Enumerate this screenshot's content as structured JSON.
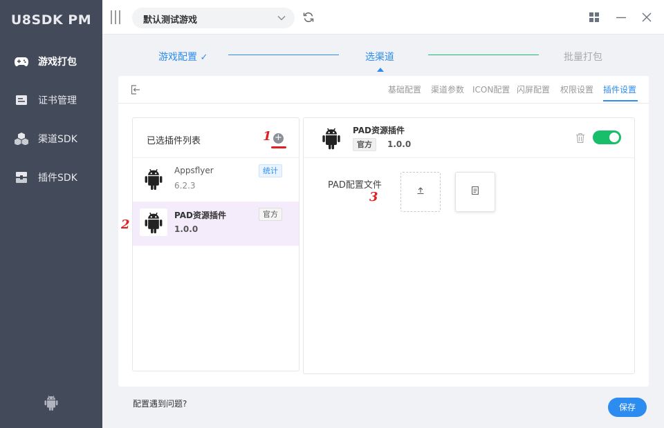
{
  "app": {
    "title": "U8SDK PM"
  },
  "sidebar": {
    "items": [
      {
        "label": "游戏打包",
        "icon": "gamepad-icon",
        "active": true
      },
      {
        "label": "证书管理",
        "icon": "certificate-icon",
        "active": false
      },
      {
        "label": "渠道SDK",
        "icon": "cubes-icon",
        "active": false
      },
      {
        "label": "插件SDK",
        "icon": "plugin-icon",
        "active": false
      }
    ],
    "bottom_icon": "android-icon"
  },
  "topbar": {
    "game_select_value": "默认测试游戏",
    "icons": [
      "menu-toggle-icon",
      "chevron-down-icon",
      "refresh-icon",
      "grid-icon",
      "minimize-icon",
      "close-icon"
    ]
  },
  "steps": [
    {
      "label": "游戏配置",
      "state": "done",
      "check": "✓"
    },
    {
      "label": "选渠道",
      "state": "current"
    },
    {
      "label": "批量打包",
      "state": "todo"
    }
  ],
  "tabs": {
    "items": [
      "基础配置",
      "渠道参数",
      "ICON配置",
      "闪屏配置",
      "权限设置",
      "插件设置"
    ],
    "active_index": 5
  },
  "plugin_list": {
    "title": "已选插件列表",
    "add_symbol": "+",
    "items": [
      {
        "name": "Appsflyer",
        "version": "6.2.3",
        "badge": "统计",
        "selected": false
      },
      {
        "name": "PAD资源插件",
        "version": "1.0.0",
        "badge": "官方",
        "selected": true
      }
    ]
  },
  "plugin_detail": {
    "name": "PAD资源插件",
    "tag": "官方",
    "version": "1.0.0",
    "enabled": true,
    "config_label": "PAD配置文件"
  },
  "footer": {
    "help_link": "配置遇到问题?",
    "save_label": "保存"
  },
  "annotations": [
    "1",
    "2",
    "3"
  ],
  "colors": {
    "sidebar_bg": "#434a59",
    "accent": "#2d8cf0",
    "toggle_on": "#19be6b",
    "step_done_line": "#2d8cf0",
    "step_next_line": "#19be6b",
    "selected_row_bg": "#f4ebfb",
    "annotation": "#e02020"
  }
}
